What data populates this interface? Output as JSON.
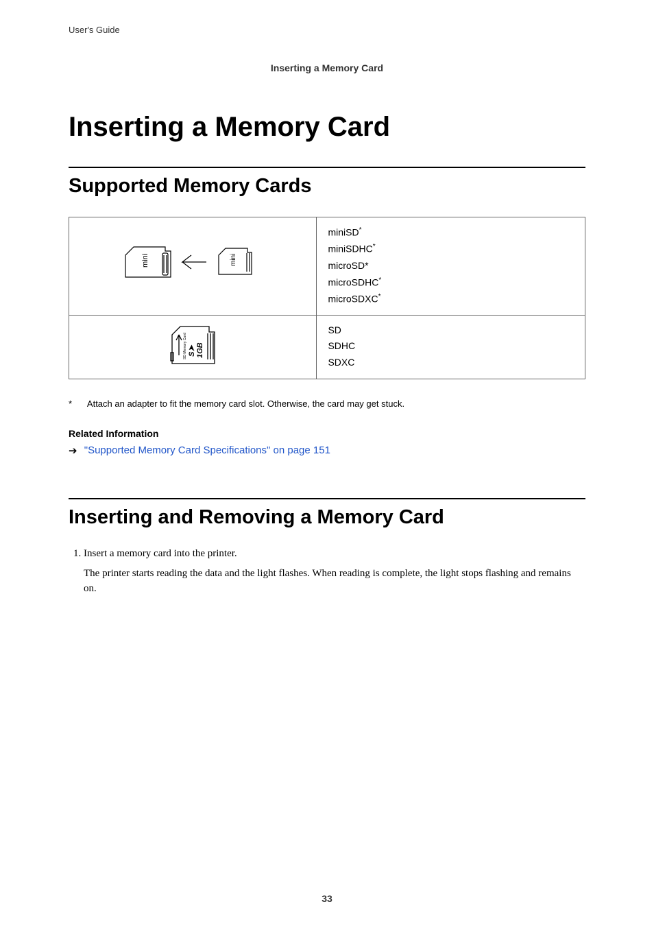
{
  "top_left": "User's Guide",
  "top_center": "Inserting a Memory Card",
  "main_title": "Inserting a Memory Card",
  "section1_title": "Supported Memory Cards",
  "table": {
    "row1": {
      "items": [
        "miniSD",
        "miniSDHC",
        "microSD*",
        "microSDHC",
        "microSDXC"
      ]
    },
    "row2": {
      "items": [
        "SD",
        "SDHC",
        "SDXC"
      ]
    }
  },
  "footnote_star": "*",
  "footnote_text": "Attach an adapter to fit the memory card slot. Otherwise, the card may get stuck.",
  "related_heading": "Related Information",
  "related_link_text": "\"Supported Memory Card Specifications\" on page 151",
  "section2_title": "Inserting and Removing a Memory Card",
  "step1_lead": "Insert a memory card into the printer.",
  "step1_body": "The printer starts reading the data and the light flashes. When reading is complete, the light stops flashing and remains on.",
  "page_number": "33"
}
